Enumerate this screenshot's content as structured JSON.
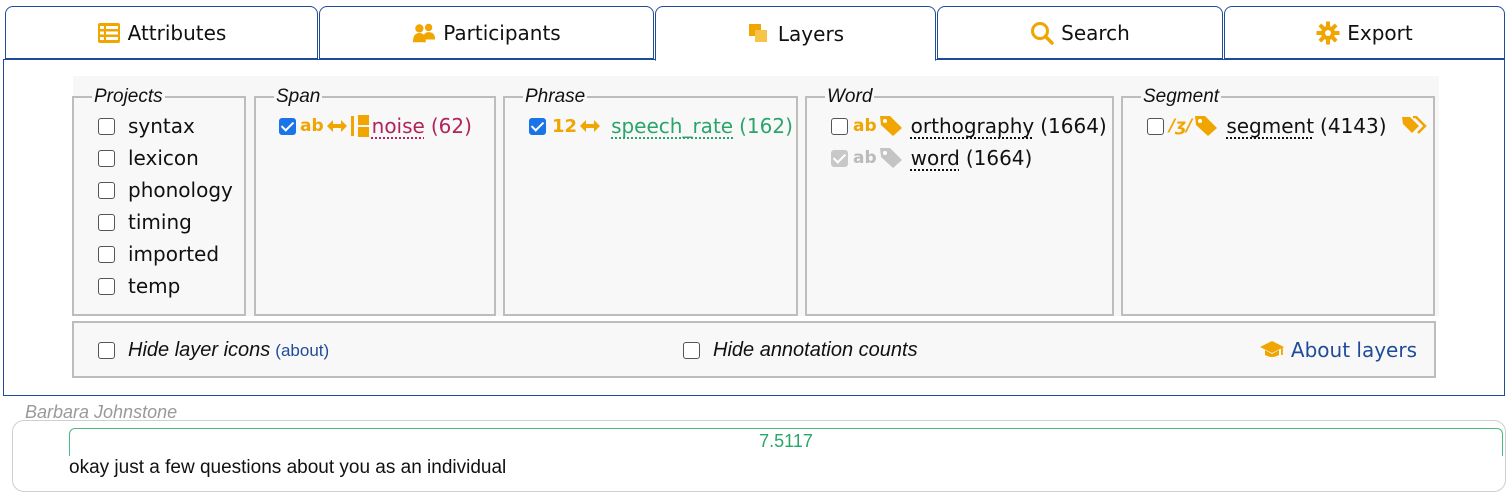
{
  "tabs": [
    {
      "label": "Attributes",
      "icon": "table-list-icon"
    },
    {
      "label": "Participants",
      "icon": "people-icon"
    },
    {
      "label": "Layers",
      "icon": "layers-icon",
      "active": true
    },
    {
      "label": "Search",
      "icon": "search-icon"
    },
    {
      "label": "Export",
      "icon": "gear-icon"
    }
  ],
  "groups": {
    "projects": {
      "legend": "Projects",
      "items": [
        {
          "label": "syntax",
          "checked": false
        },
        {
          "label": "lexicon",
          "checked": false
        },
        {
          "label": "phonology",
          "checked": false
        },
        {
          "label": "timing",
          "checked": false
        },
        {
          "label": "imported",
          "checked": false
        },
        {
          "label": "temp",
          "checked": false
        }
      ]
    },
    "span": {
      "legend": "Span",
      "layers": [
        {
          "type_tag": "ab",
          "name": "noise",
          "count": "(62)",
          "checked": true
        }
      ]
    },
    "phrase": {
      "legend": "Phrase",
      "layers": [
        {
          "type_tag": "12",
          "name": "speech_rate",
          "count": "(162)",
          "checked": true
        }
      ]
    },
    "word": {
      "legend": "Word",
      "layers": [
        {
          "type_tag": "ab",
          "name": "orthography",
          "count": "(1664)",
          "checked": false
        },
        {
          "type_tag": "ab",
          "name": "word",
          "count": "(1664)",
          "checked": true,
          "disabled": true
        }
      ]
    },
    "segment": {
      "legend": "Segment",
      "layers": [
        {
          "type_tag": "/ʒ/",
          "name": "segment",
          "count": "(4143)",
          "checked": false
        }
      ]
    }
  },
  "options": {
    "hide_icons_label": "Hide layer icons",
    "about_link": "(about)",
    "hide_counts_label": "Hide annotation counts",
    "about_layers": "About layers"
  },
  "transcript": {
    "speaker": "Barbara Johnstone",
    "speech_rate": "7.5117",
    "text": "okay just a few questions about you as an individual"
  },
  "colors": {
    "accent": "#1f4c9a",
    "icon_orange": "#f0a500",
    "noise": "#b0245a",
    "speech_rate": "#2aa56a"
  }
}
